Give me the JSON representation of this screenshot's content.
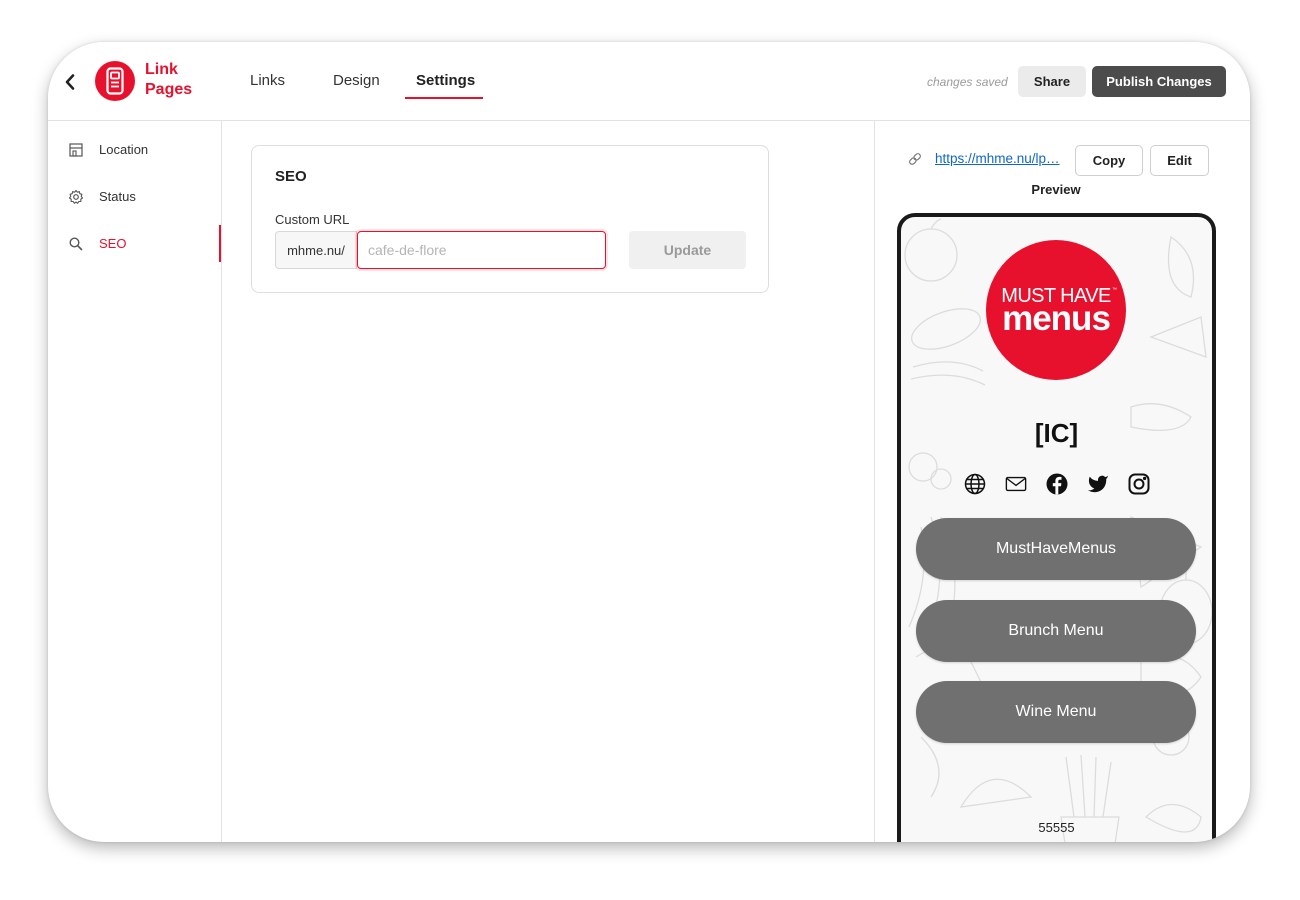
{
  "header": {
    "logo_line1": "Link",
    "logo_line2": "Pages",
    "tabs": [
      {
        "label": "Links",
        "active": false
      },
      {
        "label": "Design",
        "active": false
      },
      {
        "label": "Settings",
        "active": true
      }
    ],
    "status_text": "changes saved",
    "share_label": "Share",
    "publish_label": "Publish Changes"
  },
  "sidebar": {
    "items": [
      {
        "label": "Location",
        "icon": "storefront-icon",
        "active": false
      },
      {
        "label": "Status",
        "icon": "gear-icon",
        "active": false
      },
      {
        "label": "SEO",
        "icon": "search-icon",
        "active": true
      }
    ]
  },
  "seo": {
    "title": "SEO",
    "custom_url_label": "Custom URL",
    "prefix": "mhme.nu/",
    "placeholder": "cafe-de-flore",
    "update_label": "Update"
  },
  "preview": {
    "url": "https://mhme.nu/lp…",
    "copy_label": "Copy",
    "edit_label": "Edit",
    "title": "Preview",
    "logo_line1": "MUST HAVE",
    "logo_tm": "™",
    "logo_line2": "menus",
    "name": "[IC]",
    "social_icons": [
      "globe-icon",
      "mail-icon",
      "facebook-icon",
      "twitter-icon",
      "instagram-icon"
    ],
    "buttons": [
      {
        "label": "MustHaveMenus"
      },
      {
        "label": "Brunch Menu"
      },
      {
        "label": "Wine Menu"
      }
    ],
    "footer": "55555"
  },
  "colors": {
    "accent": "#e8112d",
    "publish_bg": "#4c4c4c",
    "link": "#1166cc",
    "preview_button": "#707070"
  }
}
